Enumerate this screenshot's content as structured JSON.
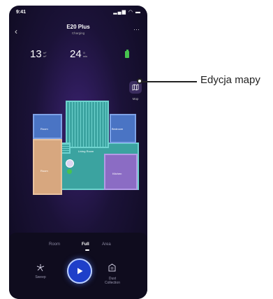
{
  "status_bar": {
    "time": "9:41",
    "icons": "signal-wifi-battery"
  },
  "header": {
    "title": "E20 Plus",
    "subtitle": "Charging",
    "back_icon": "chevron-left-icon",
    "more_label": "···"
  },
  "stats": [
    {
      "value": "13",
      "unit_top": "m²",
      "unit_bottom": "m²"
    },
    {
      "value": "24",
      "unit_top": "min",
      "unit_bottom": "min"
    }
  ],
  "battery": {
    "color": "#47c24f",
    "icon": "battery-icon"
  },
  "map_button": {
    "label": "Map",
    "icon": "map-icon"
  },
  "rooms": {
    "room": "Room",
    "bedroom": "Bedroom",
    "living_room": "Living Room",
    "room2": "Room",
    "kitchen": "Kitchen"
  },
  "modes": [
    "Room",
    "Full",
    "Area"
  ],
  "active_mode": "Full",
  "bottom": {
    "sweep_label": "Sweep",
    "dust_label_1": "Dust",
    "dust_label_2": "Collection",
    "play_icon": "play-icon"
  },
  "annotation": {
    "text": "Edycja mapy"
  },
  "colors": {
    "living": "#3ba3a0",
    "room_blue": "#4a74c4",
    "room_tan": "#d7a77f",
    "kitchen": "#8b6cc4",
    "accent": "#1e3fc9"
  }
}
